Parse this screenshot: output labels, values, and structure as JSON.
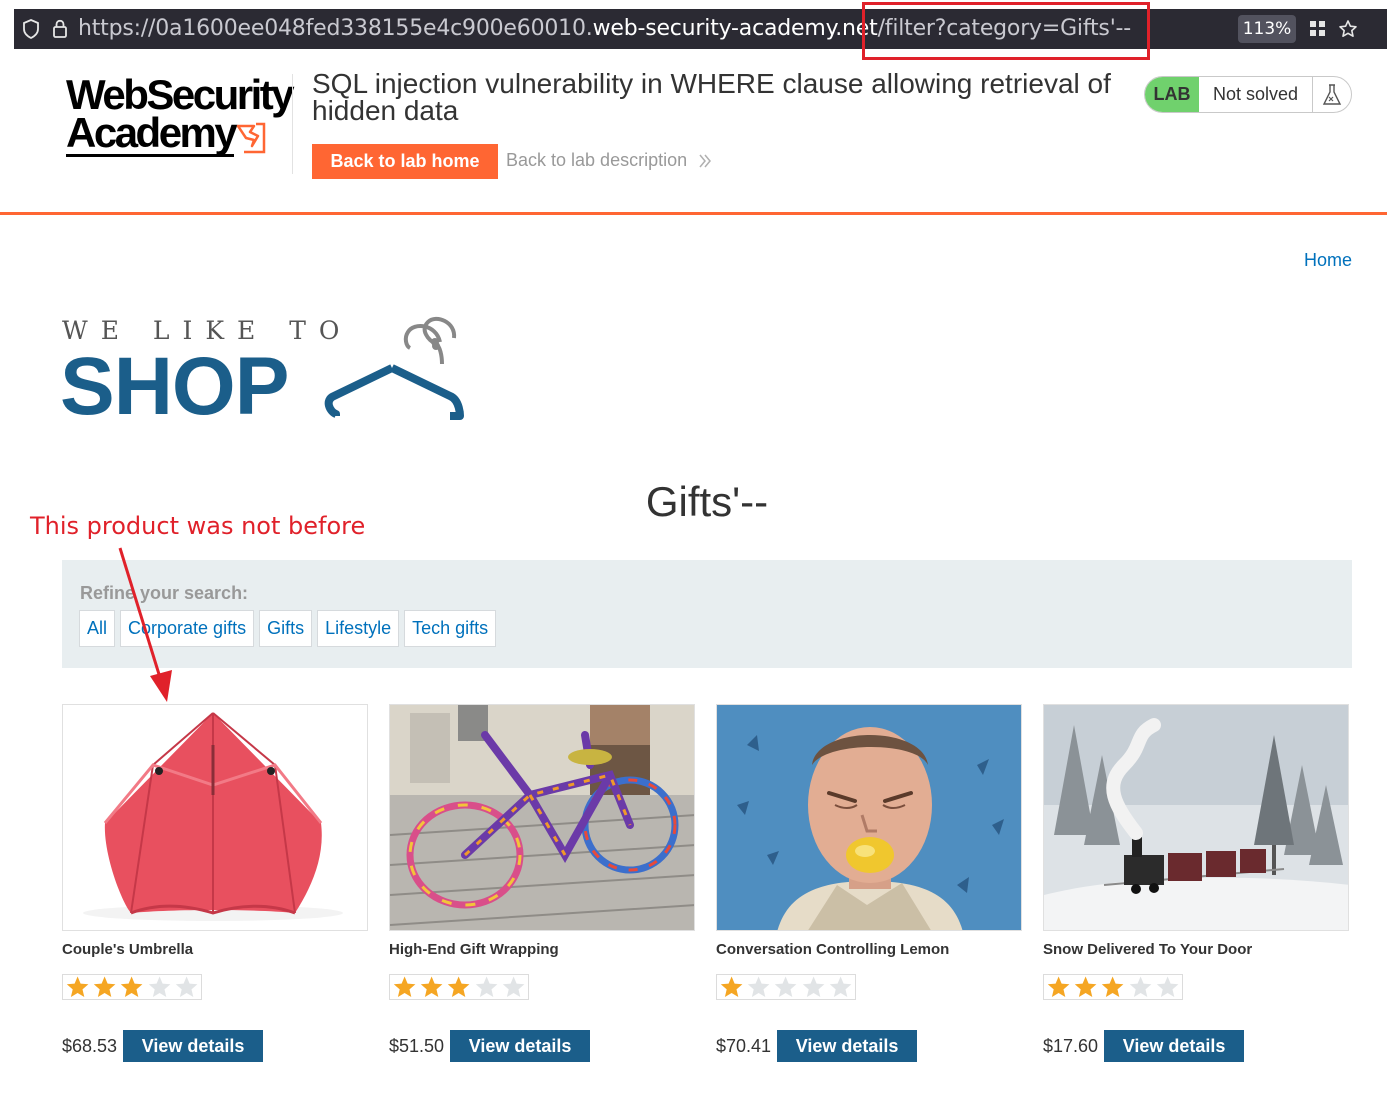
{
  "browser": {
    "url_prefix": "https://0a1600ee048fed338155e4c900e60010.",
    "url_host": "web-security-academy.net",
    "url_path": "/filter?category=Gifts'--",
    "zoom": "113%",
    "icons": [
      "shield-icon",
      "lock-icon",
      "extensions-grid-icon",
      "bookmark-star-icon"
    ]
  },
  "academy": {
    "logo_line1": "WebSecurity",
    "logo_line2": "Academy",
    "lab_title": "SQL injection vulnerability in WHERE clause allowing retrieval of hidden data",
    "back_home": "Back to lab home",
    "back_description": "Back to lab description",
    "lab_badge": "LAB",
    "lab_status": "Not solved",
    "colors": {
      "accent": "#ff6633",
      "solved_badge": "#70d16d"
    }
  },
  "shop": {
    "home_link": "Home",
    "tagline": "WE LIKE TO",
    "brand": "SHOP",
    "heading": "Gifts'--",
    "colors": {
      "brand": "#1b5e8a",
      "link": "#0071bc"
    }
  },
  "annotation": {
    "text": "This product was not before",
    "color": "#e0212a"
  },
  "filters": {
    "label": "Refine your search:",
    "items": [
      "All",
      "Corporate gifts",
      "Gifts",
      "Lifestyle",
      "Tech gifts"
    ]
  },
  "products": [
    {
      "name": "Couple's Umbrella",
      "rating": 3,
      "price": "$68.53",
      "button": "View details"
    },
    {
      "name": "High-End Gift Wrapping",
      "rating": 3,
      "price": "$51.50",
      "button": "View details"
    },
    {
      "name": "Conversation Controlling Lemon",
      "rating": 1,
      "price": "$70.41",
      "button": "View details"
    },
    {
      "name": "Snow Delivered To Your Door",
      "rating": 3,
      "price": "$17.60",
      "button": "View details"
    }
  ]
}
